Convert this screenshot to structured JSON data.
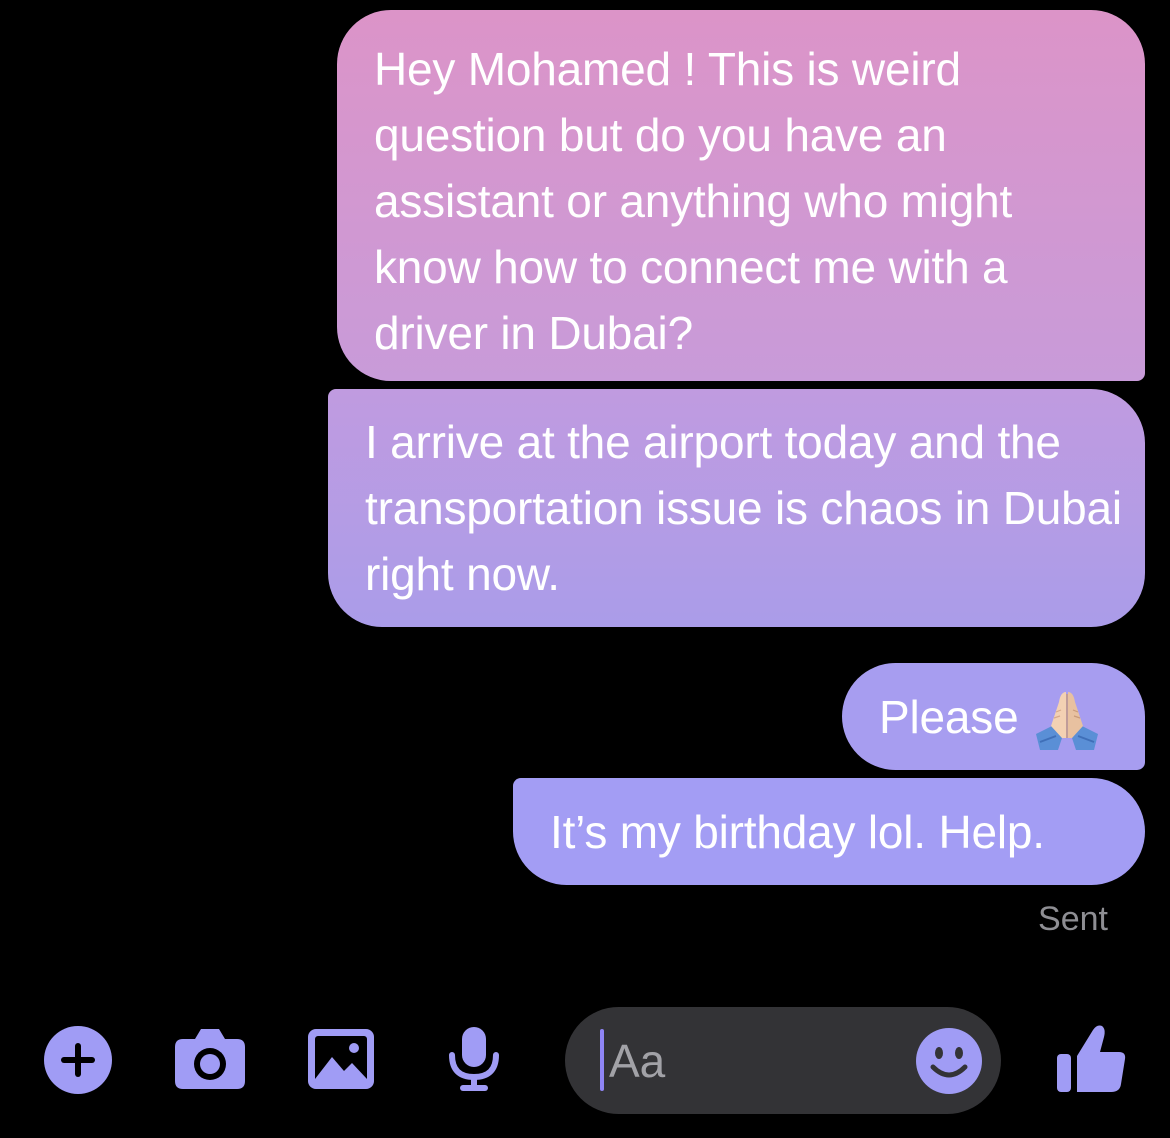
{
  "conversation": {
    "messages": [
      {
        "text": "Hey Mohamed ! This is weird question but do you have an assistant or anything who might know how to connect me with a driver in Dubai?"
      },
      {
        "text": "I arrive at the airport today and the transportation issue is chaos in Dubai right now."
      },
      {
        "text": "Please",
        "emoji": "folded-hands"
      },
      {
        "text": "It’s my birthday lol. Help."
      }
    ],
    "status": "Sent"
  },
  "composer": {
    "placeholder": "Aa",
    "icons": {
      "add": "plus-circle-icon",
      "camera": "camera-icon",
      "gallery": "photo-icon",
      "voice": "microphone-icon",
      "emoji": "smiley-icon",
      "like": "thumbs-up-icon"
    }
  },
  "colors": {
    "background": "#000000",
    "bubble_top": "#dc94c8",
    "bubble_bottom": "#a39df4",
    "accent": "#a09cf5",
    "status_text": "#8e8e93",
    "input_background": "#333336"
  }
}
